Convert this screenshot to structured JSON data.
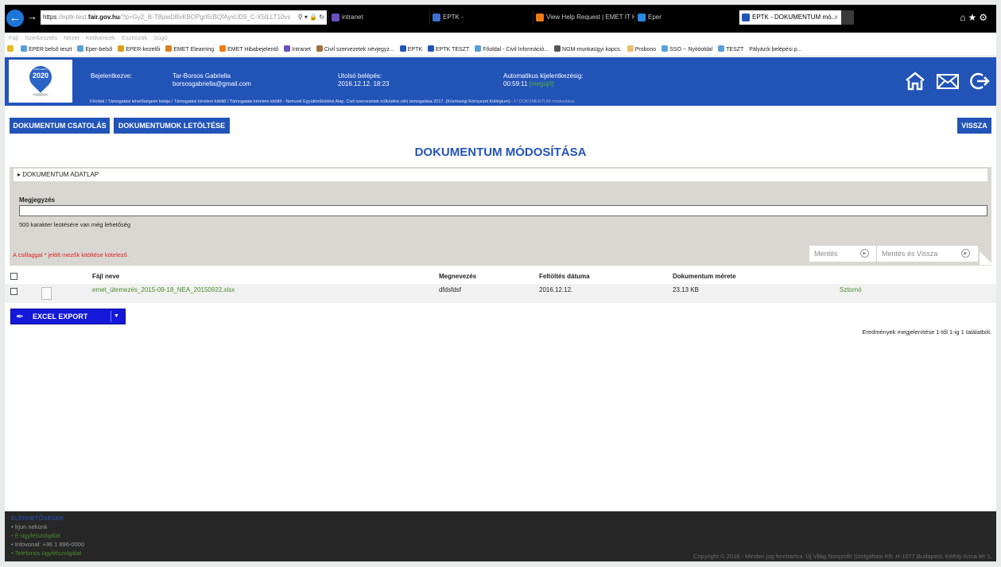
{
  "browser": {
    "address_prefix": "https",
    "address_host_pre": "://eptk-test.",
    "address_host": "fair.gov.hu",
    "address_path": "/?p=Gy2_B-TBpwDBxKBOPgrl5rBQfAyxUD9_C-X5ILLT10vs",
    "tabs": [
      {
        "label": "intranet",
        "icon_color": "#6b4fbf"
      },
      {
        "label": "EPTK -",
        "icon_color": "#3d6ec9"
      },
      {
        "label": "View Help Request | EMET IT H...",
        "icon_color": "#f07b16"
      },
      {
        "label": "Eper",
        "icon_color": "#2a8be0"
      },
      {
        "label": "EPTK - DOKUMENTUM mó...",
        "icon_color": "#2254b8"
      }
    ],
    "menu": [
      "Fájl",
      "Szerkesztés",
      "Nézet",
      "Kedvencek",
      "Eszközök",
      "Súgó"
    ],
    "favorites": [
      "EPER belső teszt",
      "Eper-belső",
      "EPER-kezelői",
      "EMET Elearning",
      "EMET Hibabejelentő",
      "Intranet",
      "Civil szervezetek névjegyz...",
      "EPTK",
      "EPTK TESZT",
      "Főoldal - Civil Információ...",
      "NGM-munkaügyi kapcs.",
      "Probono",
      "SSO -- Nyitóoldal",
      "TESZT",
      "Pályázói belépési p..."
    ]
  },
  "header": {
    "logo_text": "2020",
    "logo_small": "SZÉCHENYI",
    "logged_in_label": "Bejelentkezve:",
    "user_name": "Tar-Borsos Gabriella",
    "user_email": "borsosgabriella@gmail.com",
    "last_login_label": "Utolsó belépés:",
    "last_login_value": "2016.12.12. 18:23",
    "auto_logout_label": "Automatikus kijelentkezésig:",
    "auto_logout_time": "00:59:11",
    "auto_logout_renew": "[megújít]",
    "breadcrumb": "Főoldal  /  Támogatási lehetőségeim listája  /  Támogatási kérelem kitöltő  /  Támogatási kérelem kitöltő - Nemzeti Együttműködési Alap. Civil szervezetek működési célú támogatása 2017. (Közösségi Környezet Kollégium) -  /  ",
    "breadcrumb_current": "/  DOKUMENTUM módosítása"
  },
  "toolbar": {
    "attach_label": "DOKUMENTUM CSATOLÁS",
    "download_label": "DOKUMENTUMOK LETÖLTÉSE",
    "back_label": "VISSZA"
  },
  "page_title": "DOKUMENTUM MÓDOSÍTÁSA",
  "form": {
    "adatlap_label": "DOKUMENTUM ADATLAP",
    "note_label": "Megjegyzés",
    "note_value": "",
    "char_hint": "500 karakter leütésére van még lehetőség",
    "required_note": "A csillaggal * jelölt mezők kitöltése kötelező.",
    "save_label": "Mentés",
    "save_back_label": "Mentés és Vissza"
  },
  "table": {
    "headers": {
      "file_name": "Fájl neve",
      "title": "Megnevezés",
      "upload_date": "Feltöltés dátuma",
      "size": "Dokumentum mérete"
    },
    "rows": [
      {
        "file_name": "emet_ütemezés_2015-09-18_NEA_20150922.xlsx",
        "title": "dfdsfdsf",
        "upload_date": "2016.12.12.",
        "size": "23.13 KB",
        "action": "Sztornó"
      }
    ]
  },
  "excel_export_label": "EXCEL EXPORT",
  "results_text": "Eredmények megjelenítése 1-től 1-ig 1 találatból.",
  "footer": {
    "heading": "ELÉRHETŐSÉGEK",
    "items": [
      {
        "label": "Írjon nekünk",
        "color": "#9a9a9a"
      },
      {
        "label": "E-ügyfélszolgálat",
        "color": "#4a8a2a"
      },
      {
        "label": "Infovonal: +36 1 896-0000",
        "color": "#9a9a9a"
      },
      {
        "label": "Telefonos ügyfélszolgálat",
        "color": "#4a8a2a"
      }
    ],
    "copyright": "Copyright © 2016 - Minden jog fenntartva. Új Világ Nonprofit Szolgáltató Kft. H-1077 Budapest, Kéthly Anna tér 1."
  },
  "colors": {
    "brand_blue": "#2254b8",
    "excel_blue": "#1418d8",
    "link_green": "#4a8a2a",
    "required_red": "#e02020"
  }
}
